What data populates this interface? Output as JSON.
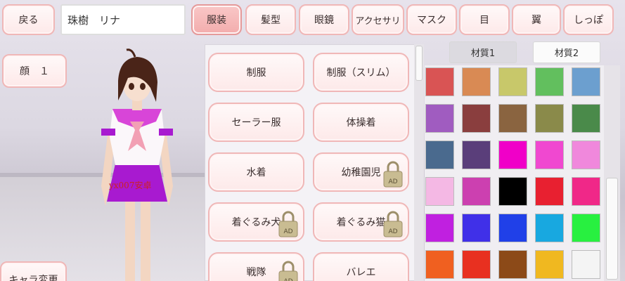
{
  "header": {
    "back_label": "戻る",
    "character_name": "珠樹　リナ",
    "tabs": [
      {
        "label": "服装",
        "active": true
      },
      {
        "label": "髪型",
        "active": false
      },
      {
        "label": "眼鏡",
        "active": false
      },
      {
        "label": "アクセサリ",
        "active": false
      },
      {
        "label": "マスク",
        "active": false
      },
      {
        "label": "目",
        "active": false
      },
      {
        "label": "翼",
        "active": false
      },
      {
        "label": "しっぽ",
        "active": false
      }
    ]
  },
  "left": {
    "face_label": "顔　１",
    "change_character_label": "キャラ変更"
  },
  "watermark": "yx007安卓",
  "clothing": {
    "items": [
      {
        "label": "制服",
        "ad": false
      },
      {
        "label": "制服（スリム）",
        "ad": false
      },
      {
        "label": "セーラー服",
        "ad": false
      },
      {
        "label": "体操着",
        "ad": false
      },
      {
        "label": "水着",
        "ad": false
      },
      {
        "label": "幼稚園児",
        "ad": true
      },
      {
        "label": "着ぐるみ犬",
        "ad": true
      },
      {
        "label": "着ぐるみ猫",
        "ad": true
      },
      {
        "label": "戦隊",
        "ad": true
      },
      {
        "label": "バレエ",
        "ad": false
      }
    ],
    "ad_badge": "AD"
  },
  "materials": {
    "tabs": [
      {
        "label": "材質1",
        "selected": true
      },
      {
        "label": "材質2",
        "selected": false
      }
    ]
  },
  "palette": [
    [
      "#d95454",
      "#d98a54",
      "#c8c86a",
      "#62bf5e",
      "#6c9fcf"
    ],
    [
      "#a05cc0",
      "#8a3e3e",
      "#8a6440",
      "#8a8a4a",
      "#4a8a4a"
    ],
    [
      "#4a6a8e",
      "#5a3e7a",
      "#f000c8",
      "#f048d0",
      "#f088dc"
    ],
    [
      "#f4b8e4",
      "#cc40b0",
      "#000000",
      "#e82030",
      "#f02888"
    ],
    [
      "#c020e0",
      "#4030e8",
      "#2040e8",
      "#18a8e0",
      "#28f040"
    ],
    [
      "#f06020",
      "#e83020",
      "#8c4a18",
      "#f0b820",
      "#f4f4f4"
    ]
  ]
}
